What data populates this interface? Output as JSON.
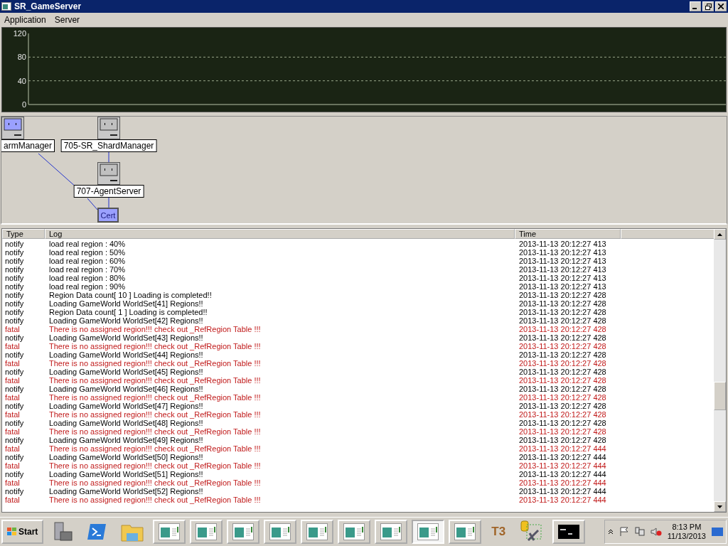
{
  "window": {
    "title": "SR_GameServer"
  },
  "menu": [
    {
      "label": "Application"
    },
    {
      "label": "Server"
    }
  ],
  "chart": {
    "y_axis_labels": [
      "120",
      "80",
      "40",
      "0"
    ]
  },
  "diagram": {
    "nodes": [
      {
        "label": "armManager",
        "active": true
      },
      {
        "label": "705-SR_ShardManager",
        "active": false
      },
      {
        "label": "707-AgentServer",
        "active": false
      },
      {
        "label": "Cert",
        "active": true
      }
    ]
  },
  "table": {
    "columns": [
      "Type",
      "Log",
      "Time"
    ],
    "rows": [
      {
        "kind": "notify",
        "type": "notify",
        "log": "load real region : 40%",
        "time": "2013-11-13 20:12:27 413"
      },
      {
        "kind": "notify",
        "type": "notify",
        "log": "load real region : 50%",
        "time": "2013-11-13 20:12:27 413"
      },
      {
        "kind": "notify",
        "type": "notify",
        "log": "load real region : 60%",
        "time": "2013-11-13 20:12:27 413"
      },
      {
        "kind": "notify",
        "type": "notify",
        "log": "load real region : 70%",
        "time": "2013-11-13 20:12:27 413"
      },
      {
        "kind": "notify",
        "type": "notify",
        "log": "load real region : 80%",
        "time": "2013-11-13 20:12:27 413"
      },
      {
        "kind": "notify",
        "type": "notify",
        "log": "load real region : 90%",
        "time": "2013-11-13 20:12:27 413"
      },
      {
        "kind": "notify",
        "type": "notify",
        "log": "Region Data count[ 10 ] Loading is completed!!",
        "time": "2013-11-13 20:12:27 428"
      },
      {
        "kind": "notify",
        "type": "notify",
        "log": "Loading GameWorld WorldSet[41] Regions!!",
        "time": "2013-11-13 20:12:27 428"
      },
      {
        "kind": "notify",
        "type": "notify",
        "log": "Region Data count[ 1 ] Loading is completed!!",
        "time": "2013-11-13 20:12:27 428"
      },
      {
        "kind": "notify",
        "type": "notify",
        "log": "Loading GameWorld WorldSet[42] Regions!!",
        "time": "2013-11-13 20:12:27 428"
      },
      {
        "kind": "fatal",
        "type": "fatal",
        "log": "There is no assigned region!!! check out _RefRegion Table !!!",
        "time": "2013-11-13 20:12:27 428"
      },
      {
        "kind": "notify",
        "type": "notify",
        "log": "Loading GameWorld WorldSet[43] Regions!!",
        "time": "2013-11-13 20:12:27 428"
      },
      {
        "kind": "fatal",
        "type": "fatal",
        "log": "There is no assigned region!!! check out _RefRegion Table !!!",
        "time": "2013-11-13 20:12:27 428"
      },
      {
        "kind": "notify",
        "type": "notify",
        "log": "Loading GameWorld WorldSet[44] Regions!!",
        "time": "2013-11-13 20:12:27 428"
      },
      {
        "kind": "fatal",
        "type": "fatal",
        "log": "There is no assigned region!!! check out _RefRegion Table !!!",
        "time": "2013-11-13 20:12:27 428"
      },
      {
        "kind": "notify",
        "type": "notify",
        "log": "Loading GameWorld WorldSet[45] Regions!!",
        "time": "2013-11-13 20:12:27 428"
      },
      {
        "kind": "fatal",
        "type": "fatal",
        "log": "There is no assigned region!!! check out _RefRegion Table !!!",
        "time": "2013-11-13 20:12:27 428"
      },
      {
        "kind": "notify",
        "type": "notify",
        "log": "Loading GameWorld WorldSet[46] Regions!!",
        "time": "2013-11-13 20:12:27 428"
      },
      {
        "kind": "fatal",
        "type": "fatal",
        "log": "There is no assigned region!!! check out _RefRegion Table !!!",
        "time": "2013-11-13 20:12:27 428"
      },
      {
        "kind": "notify",
        "type": "notify",
        "log": "Loading GameWorld WorldSet[47] Regions!!",
        "time": "2013-11-13 20:12:27 428"
      },
      {
        "kind": "fatal",
        "type": "fatal",
        "log": "There is no assigned region!!! check out _RefRegion Table !!!",
        "time": "2013-11-13 20:12:27 428"
      },
      {
        "kind": "notify",
        "type": "notify",
        "log": "Loading GameWorld WorldSet[48] Regions!!",
        "time": "2013-11-13 20:12:27 428"
      },
      {
        "kind": "fatal",
        "type": "fatal",
        "log": "There is no assigned region!!! check out _RefRegion Table !!!",
        "time": "2013-11-13 20:12:27 428"
      },
      {
        "kind": "notify",
        "type": "notify",
        "log": "Loading GameWorld WorldSet[49] Regions!!",
        "time": "2013-11-13 20:12:27 428"
      },
      {
        "kind": "fatal",
        "type": "fatal",
        "log": "There is no assigned region!!! check out _RefRegion Table !!!",
        "time": "2013-11-13 20:12:27 444"
      },
      {
        "kind": "notify",
        "type": "notify",
        "log": "Loading GameWorld WorldSet[50] Regions!!",
        "time": "2013-11-13 20:12:27 444"
      },
      {
        "kind": "fatal",
        "type": "fatal",
        "log": "There is no assigned region!!! check out _RefRegion Table !!!",
        "time": "2013-11-13 20:12:27 444"
      },
      {
        "kind": "notify",
        "type": "notify",
        "log": "Loading GameWorld WorldSet[51] Regions!!",
        "time": "2013-11-13 20:12:27 444"
      },
      {
        "kind": "fatal",
        "type": "fatal",
        "log": "There is no assigned region!!! check out _RefRegion Table !!!",
        "time": "2013-11-13 20:12:27 444"
      },
      {
        "kind": "notify",
        "type": "notify",
        "log": "Loading GameWorld WorldSet[52] Regions!!",
        "time": "2013-11-13 20:12:27 444"
      },
      {
        "kind": "fatal",
        "type": "fatal",
        "log": "There is no assigned region!!! check out _RefRegion Table !!!",
        "time": "2013-11-13 20:12:27 444"
      }
    ]
  },
  "taskbar": {
    "start": "Start",
    "windows": [
      {
        "selected": false
      },
      {
        "selected": false
      },
      {
        "selected": false
      },
      {
        "selected": false
      },
      {
        "selected": false
      },
      {
        "selected": false
      },
      {
        "selected": false
      },
      {
        "selected": true
      },
      {
        "selected": false
      }
    ],
    "t3": "T3",
    "clock": {
      "time": "8:13 PM",
      "date": "11/13/2013"
    }
  }
}
